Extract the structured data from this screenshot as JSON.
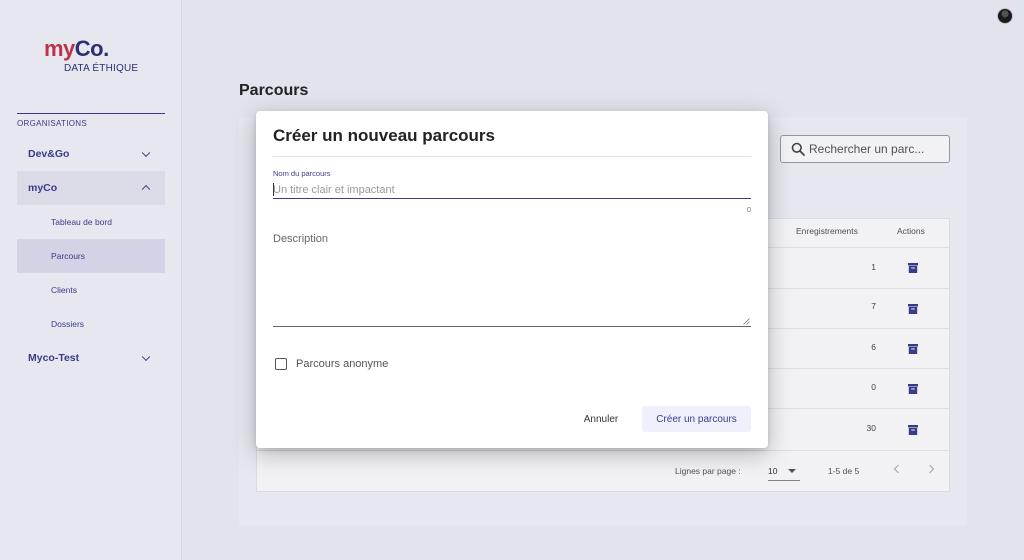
{
  "app": {
    "logo_main_my": "my",
    "logo_main_co": "Co.",
    "logo_sub": "DATA ÉTHIQUE"
  },
  "sidebar": {
    "section_label": "ORGANISATIONS",
    "orgs": [
      {
        "label": "Dev&Go",
        "expanded": false
      },
      {
        "label": "myCo",
        "expanded": true,
        "items": [
          {
            "label": "Tableau de bord",
            "active": false
          },
          {
            "label": "Parcours",
            "active": true
          },
          {
            "label": "Clients",
            "active": false
          },
          {
            "label": "Dossiers",
            "active": false
          }
        ]
      },
      {
        "label": "Myco-Test",
        "expanded": false
      }
    ]
  },
  "main": {
    "title": "Parcours",
    "search_placeholder": "Rechercher un parc...",
    "table": {
      "columns": [
        "Enregistrements",
        "Actions"
      ],
      "rows": [
        {
          "enregistrements": "1",
          "action_icon": "archive-icon"
        },
        {
          "enregistrements": "7",
          "action_icon": "archive-icon"
        },
        {
          "enregistrements": "6",
          "action_icon": "archive-icon"
        },
        {
          "enregistrements": "0",
          "action_icon": "archive-icon"
        },
        {
          "enregistrements": "30",
          "action_icon": "archive-icon"
        }
      ]
    },
    "pagination": {
      "rows_per_page_label": "Lignes par page :",
      "rows_per_page_value": "10",
      "range": "1-5 de 5"
    }
  },
  "dialog": {
    "title": "Créer un nouveau parcours",
    "name_field": {
      "label": "Nom du parcours",
      "placeholder": "Un titre clair et impactant",
      "value": "",
      "count": "0"
    },
    "description_field": {
      "label": "Description",
      "value": ""
    },
    "anonymous_checkbox": {
      "label": "Parcours anonyme",
      "checked": false
    },
    "cancel_label": "Annuler",
    "create_label": "Créer un parcours"
  },
  "colors": {
    "brand_primary": "#3a3d8f",
    "brand_accent": "#c8344a",
    "background": "#eef0f7"
  }
}
